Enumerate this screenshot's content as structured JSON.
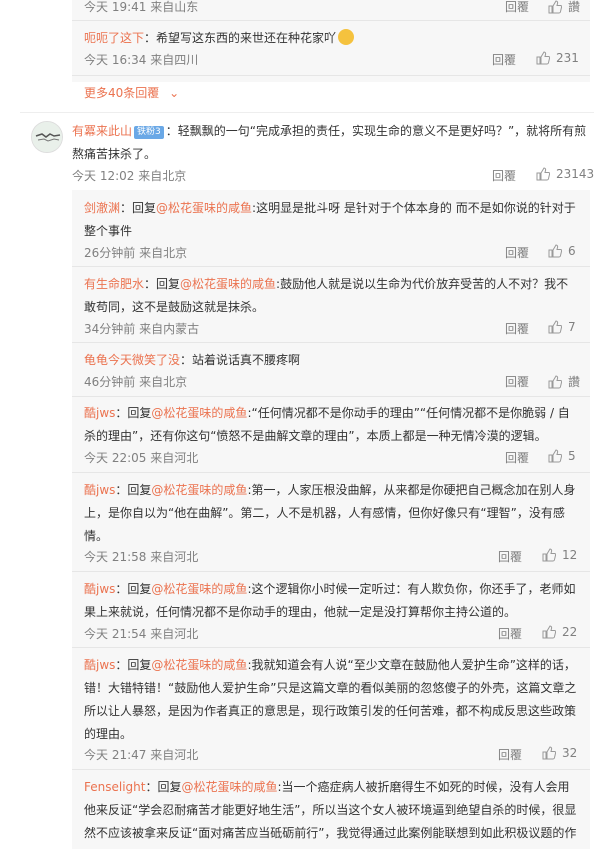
{
  "top_partial": {
    "meta": "今天 19:41 来自山东",
    "reply": "回覆",
    "like": "讚"
  },
  "sub1": {
    "user": "呃呃了这下",
    "text": "：希望写这东西的来世还在种花家吖",
    "meta": "今天 16:34 来自四川",
    "reply": "回覆",
    "likes": "231"
  },
  "more_label": "更多40条回覆",
  "main": {
    "user": "有冪来此山",
    "badge": "铁粉3",
    "text": "：轻飘飘的一句“完成承担的责任，实现生命的意义不是更好吗？”，就将所有煎熬痛苦抹杀了。",
    "meta": "今天 12:02 来自北京",
    "reply": "回覆",
    "likes": "23143"
  },
  "replies": [
    {
      "user": "剑澈渊",
      "prefix": "：回复",
      "mention": "@松花蛋味的咸鱼",
      "text": ":这明显是批斗呀 是针对于个体本身的 而不是如你说的针对于整个事件",
      "meta": "26分钟前 来自北京",
      "reply": "回覆",
      "likes": "6"
    },
    {
      "user": "有生命肥水",
      "prefix": "：回复",
      "mention": "@松花蛋味的咸鱼",
      "text": ":鼓励他人就是说以生命为代价放弃受苦的人不对？我不敢苟同，这不是鼓励这就是抹杀。",
      "meta": "34分钟前 来自内蒙古",
      "reply": "回覆",
      "likes": "7"
    },
    {
      "user": "龟龟今天微笑了没",
      "prefix": "",
      "mention": "",
      "text": "：站着说话真不腰疼啊",
      "meta": "46分钟前 来自北京",
      "reply": "回覆",
      "likes": "讚"
    },
    {
      "user": "酷jws",
      "prefix": "：回复",
      "mention": "@松花蛋味的咸鱼",
      "text": ":“任何情况都不是你动手的理由”“任何情况都不是你脆弱 / 自杀的理由”，还有你这句“愤怒不是曲解文章的理由”，本质上都是一种无情冷漠的逻辑。",
      "meta": "今天 22:05 来自河北",
      "reply": "回覆",
      "likes": "5"
    },
    {
      "user": "酷jws",
      "prefix": "：回复",
      "mention": "@松花蛋味的咸鱼",
      "text": ":第一，人家压根没曲解，从来都是你硬把自己概念加在别人身上，是你自以为“他在曲解”。第二，人不是机器，人有感情，但你好像只有“理智”，没有感情。",
      "meta": "今天 21:58 来自河北",
      "reply": "回覆",
      "likes": "12"
    },
    {
      "user": "酷jws",
      "prefix": "：回复",
      "mention": "@松花蛋味的咸鱼",
      "text": ":这个逻辑你小时候一定听过：有人欺负你，你还手了，老师如果上来就说，任何情况都不是你动手的理由，他就一定是没打算帮你主持公道的。",
      "meta": "今天 21:54 来自河北",
      "reply": "回覆",
      "likes": "22"
    },
    {
      "user": "酷jws",
      "prefix": "：回复",
      "mention": "@松花蛋味的咸鱼",
      "text": ":我就知道会有人说“至少文章在鼓励他人爱护生命”这样的话，错！大错特错！“鼓励他人爱护生命”只是这篇文章的看似美丽的忽悠傻子的外壳，这篇文章之所以让人暴怒，是因为作者真正的意思是，现行政策引发的任何苦难，都不构成反思这些政策的理由。",
      "meta": "今天 21:47 来自河北",
      "reply": "回覆",
      "likes": "32"
    },
    {
      "user": "Fenselight",
      "prefix": "：回复",
      "mention": "@松花蛋味的咸鱼",
      "text": ":当一个癌症病人被折磨得生不如死的时候，没有人会用他来反证“学会忍耐痛苦才能更好地生活”，所以当这个女人被环境逼到绝望自杀的时候，很显然不应该被拿来反证“面对痛苦应当砥砺前行”，我觉得通过此案例能联想到如此积极议题的作者",
      "meta": "",
      "reply": "",
      "likes": ""
    }
  ]
}
